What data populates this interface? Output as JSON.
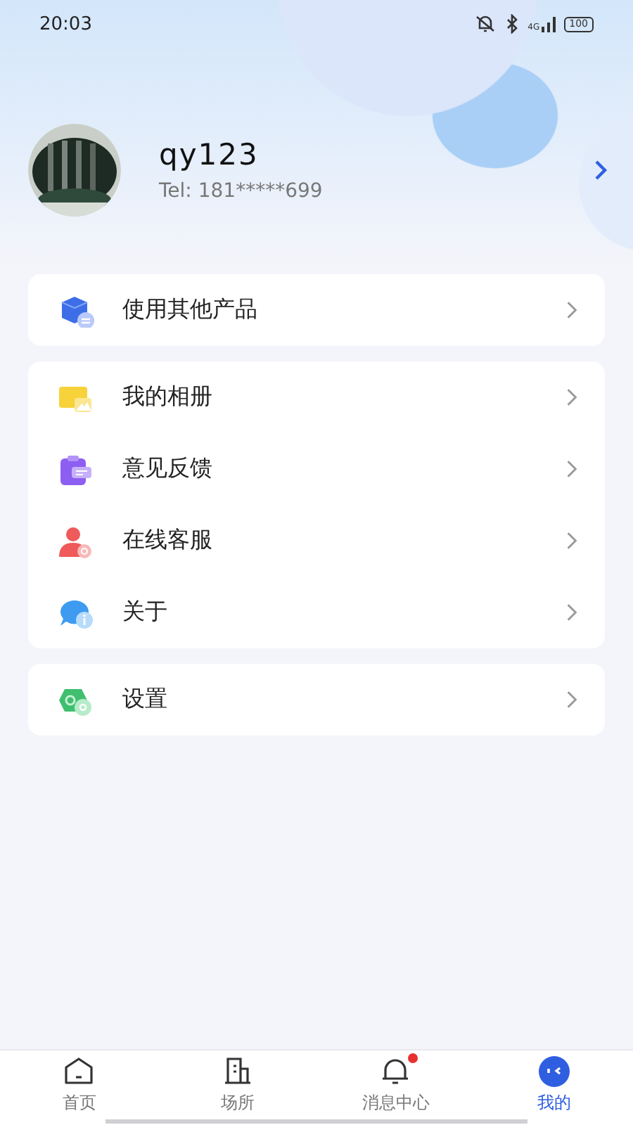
{
  "status_bar": {
    "time": "20:03",
    "network": "4G",
    "battery": "100"
  },
  "profile": {
    "name": "qy123",
    "phone": "Tel:  181*****699"
  },
  "menu_groups": [
    {
      "items": [
        {
          "label": "使用其他产品",
          "kind": "cube"
        }
      ]
    },
    {
      "items": [
        {
          "label": "我的相册",
          "kind": "album"
        },
        {
          "label": "意见反馈",
          "kind": "feedback"
        },
        {
          "label": "在线客服",
          "kind": "service"
        },
        {
          "label": "关于",
          "kind": "about"
        }
      ]
    },
    {
      "items": [
        {
          "label": "设置",
          "kind": "settings"
        }
      ]
    }
  ],
  "tab_bar": [
    {
      "label": "首页",
      "kind": "home",
      "selected": false,
      "badge": false
    },
    {
      "label": "场所",
      "kind": "building",
      "selected": false,
      "badge": false
    },
    {
      "label": "消息中心",
      "kind": "bell",
      "selected": false,
      "badge": true
    },
    {
      "label": "我的",
      "kind": "face",
      "selected": true,
      "badge": false
    }
  ]
}
